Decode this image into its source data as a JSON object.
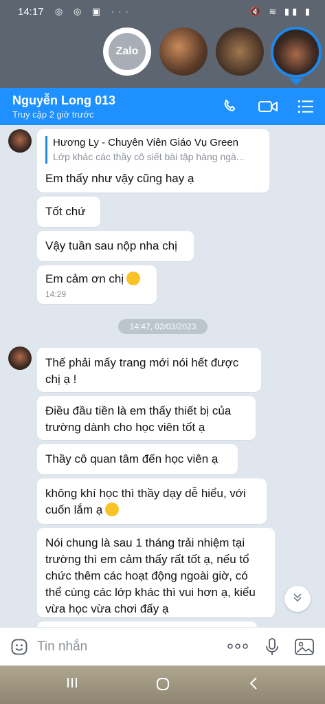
{
  "status_bar": {
    "time": "14:17",
    "left_icons": "◎ ◎ ▣ ···",
    "right_icons": "🔇 ≋ ▮▮ ▮"
  },
  "bubbles": {
    "zalo_label": "Zalo"
  },
  "header": {
    "name": "Nguyễn Long 013",
    "subtitle": "Truy cập 2 giờ trước"
  },
  "messages": [
    {
      "quote_title": "Hương Ly - Chuyên Viên Giáo Vụ Green",
      "quote_snippet": "Lớp khác các thầy cô siết bài tập hàng ngà...",
      "text": "Em thấy như vậy cũng hay ạ"
    },
    {
      "text": "Tốt chứ"
    },
    {
      "text": "Vậy tuần sau nộp nha chị"
    },
    {
      "text": "Em cảm ơn chị",
      "time": "14:29"
    }
  ],
  "date_separator": "14:47, 02/03/2023",
  "messages2": [
    {
      "text": "Thế phải mấy trang mới nói hết được chị ạ !"
    },
    {
      "text": "Điều đầu tiền là em thấy thiết bị của trường dành cho học viên tốt ạ"
    },
    {
      "text": "Thầy cô quan tâm đến học viên ạ"
    },
    {
      "text": "không khí học thì thầy dạy dễ hiểu, với cuốn lắm ạ"
    },
    {
      "text": "Nói chung là sau 1 tháng trải nhiệm tại trường thì em cảm thấy rất tốt ạ, nếu tổ chức thêm các hoạt động ngoài giờ, có thể cùng các lớp khác thì vui hơn ạ, kiểu vừa học vừa chơi đấy ạ"
    }
  ],
  "input": {
    "placeholder": "Tin nhắn"
  },
  "colors": {
    "header": "#1e90ff",
    "chat_bg": "#dfe6ee",
    "bubble": "#ffffff",
    "status_bg": "#5d6570"
  }
}
